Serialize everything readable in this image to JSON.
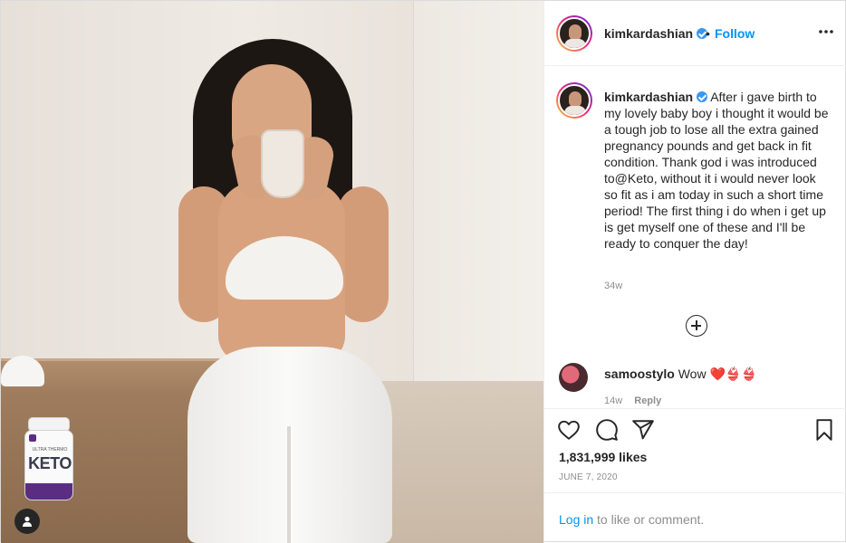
{
  "post": {
    "username": "kimkardashian",
    "follow_separator": "•",
    "follow_label": "Follow",
    "more_label": "•••",
    "caption_username": "kimkardashian",
    "caption_text": "After i gave birth to my lovely baby boy i thought it would be a tough job to lose all the extra gained pregnancy pounds and get back in fit condition. Thank god i was introduced to@Keto, without it i would never look so fit as i am today in such a short time period! The first thing i do when i get up is get myself one of these and I'll be ready to conquer the day!",
    "caption_time": "34w",
    "likes": "1,831,999 likes",
    "date": "JUNE 7, 2020"
  },
  "comments": [
    {
      "username": "samoostylo",
      "text": "Wow",
      "emoji": "❤️👙👙",
      "time": "14w",
      "reply_label": "Reply"
    }
  ],
  "photo_overlay": {
    "product_word": "KETO",
    "product_sub": "ULTRA THERMO"
  },
  "login": {
    "link_label": "Log in",
    "rest_text": " to like or comment."
  },
  "icons": {
    "like": "heart-icon",
    "comment": "comment-icon",
    "share": "paper-plane-icon",
    "save": "bookmark-icon",
    "tagged": "user-tag-icon",
    "verified": "verified-badge-icon",
    "load_more": "plus-circle-icon"
  },
  "colors": {
    "accent": "#0095f6",
    "verified": "#3897f0",
    "muted_text": "#8e8e8e",
    "text": "#262626"
  }
}
